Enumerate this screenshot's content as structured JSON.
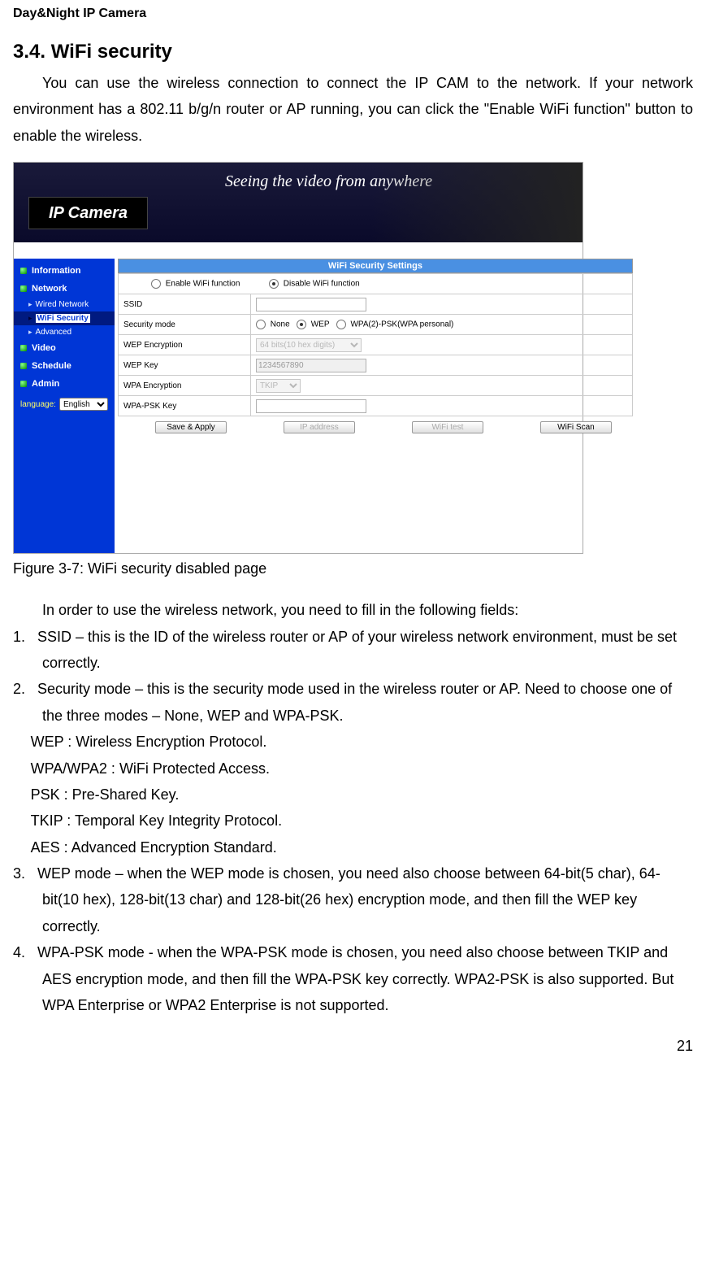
{
  "doc_header": "Day&Night IP Camera",
  "section_number": "3.4.",
  "section_title": "WiFi security",
  "intro_text": "You can use the wireless connection to connect the IP CAM to the network. If your network environment has a 802.11 b/g/n router or AP running, you can click the \"Enable WiFi function\" button to enable the wireless.",
  "screenshot": {
    "logo": "IP Camera",
    "slogan": "Seeing the video from anywhere",
    "nav": {
      "information": "Information",
      "network": "Network",
      "wired": "Wired Network",
      "wifi": "WiFi Security",
      "advanced": "Advanced",
      "video": "Video",
      "schedule": "Schedule",
      "admin": "Admin"
    },
    "language_label": "language:",
    "language_value": "English",
    "form": {
      "title": "WiFi Security Settings",
      "enable_label": "Enable WiFi function",
      "disable_label": "Disable WiFi function",
      "ssid_label": "SSID",
      "ssid_value": "",
      "secmode_label": "Security mode",
      "secmode_none": "None",
      "secmode_wep": "WEP",
      "secmode_wpa": "WPA(2)-PSK(WPA personal)",
      "wep_enc_label": "WEP Encryption",
      "wep_enc_value": "64 bits(10 hex digits)",
      "wep_key_label": "WEP Key",
      "wep_key_value": "1234567890",
      "wpa_enc_label": "WPA Encryption",
      "wpa_enc_value": "TKIP",
      "wpa_psk_label": "WPA-PSK Key",
      "wpa_psk_value": ""
    },
    "buttons": {
      "save": "Save & Apply",
      "ip": "IP address",
      "test": "WiFi test",
      "scan": "WiFi Scan"
    }
  },
  "figure_caption": "Figure 3-7: WiFi security disabled page",
  "follow_text": "In order to use the wireless network, you need to fill in the following fields:",
  "item1_num": "1.",
  "item1": "SSID – this is the ID of the wireless router or AP of your wireless network environment, must be set correctly.",
  "item2_num": "2.",
  "item2": "Security mode – this is the security mode used in the wireless router or AP. Need to choose one of the three modes – None, WEP and WPA-PSK.",
  "sub_wep": "WEP : Wireless Encryption Protocol.",
  "sub_wpa": "WPA/WPA2 : WiFi Protected Access.",
  "sub_psk": "PSK : Pre-Shared Key.",
  "sub_tkip": "TKIP : Temporal Key Integrity Protocol.",
  "sub_aes": "AES : Advanced Encryption Standard.",
  "item3_num": "3.",
  "item3": "WEP mode – when the WEP mode is chosen, you need also choose between 64-bit(5 char), 64-bit(10 hex), 128-bit(13 char) and 128-bit(26 hex) encryption mode, and then fill the WEP key correctly.",
  "item4_num": "4.",
  "item4": "WPA-PSK mode - when the WPA-PSK mode is chosen, you need also choose between TKIP and AES encryption mode, and then fill the WPA-PSK key correctly. WPA2-PSK is also supported. But WPA Enterprise or WPA2 Enterprise is not supported.",
  "page_number": "21"
}
